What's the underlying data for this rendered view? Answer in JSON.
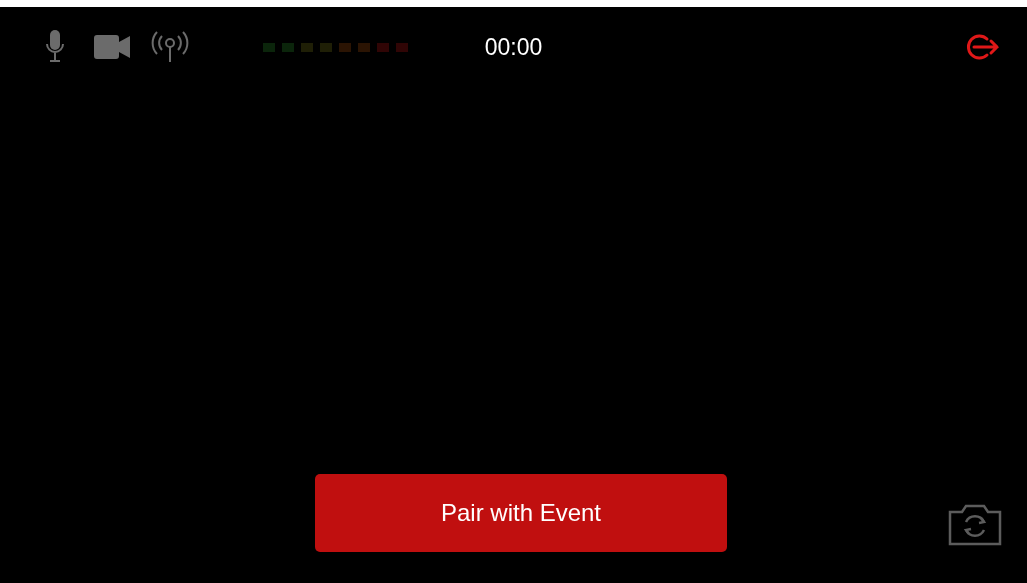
{
  "top_bar": {
    "timer": "00:00"
  },
  "pair_button": {
    "label": "Pair with Event"
  }
}
